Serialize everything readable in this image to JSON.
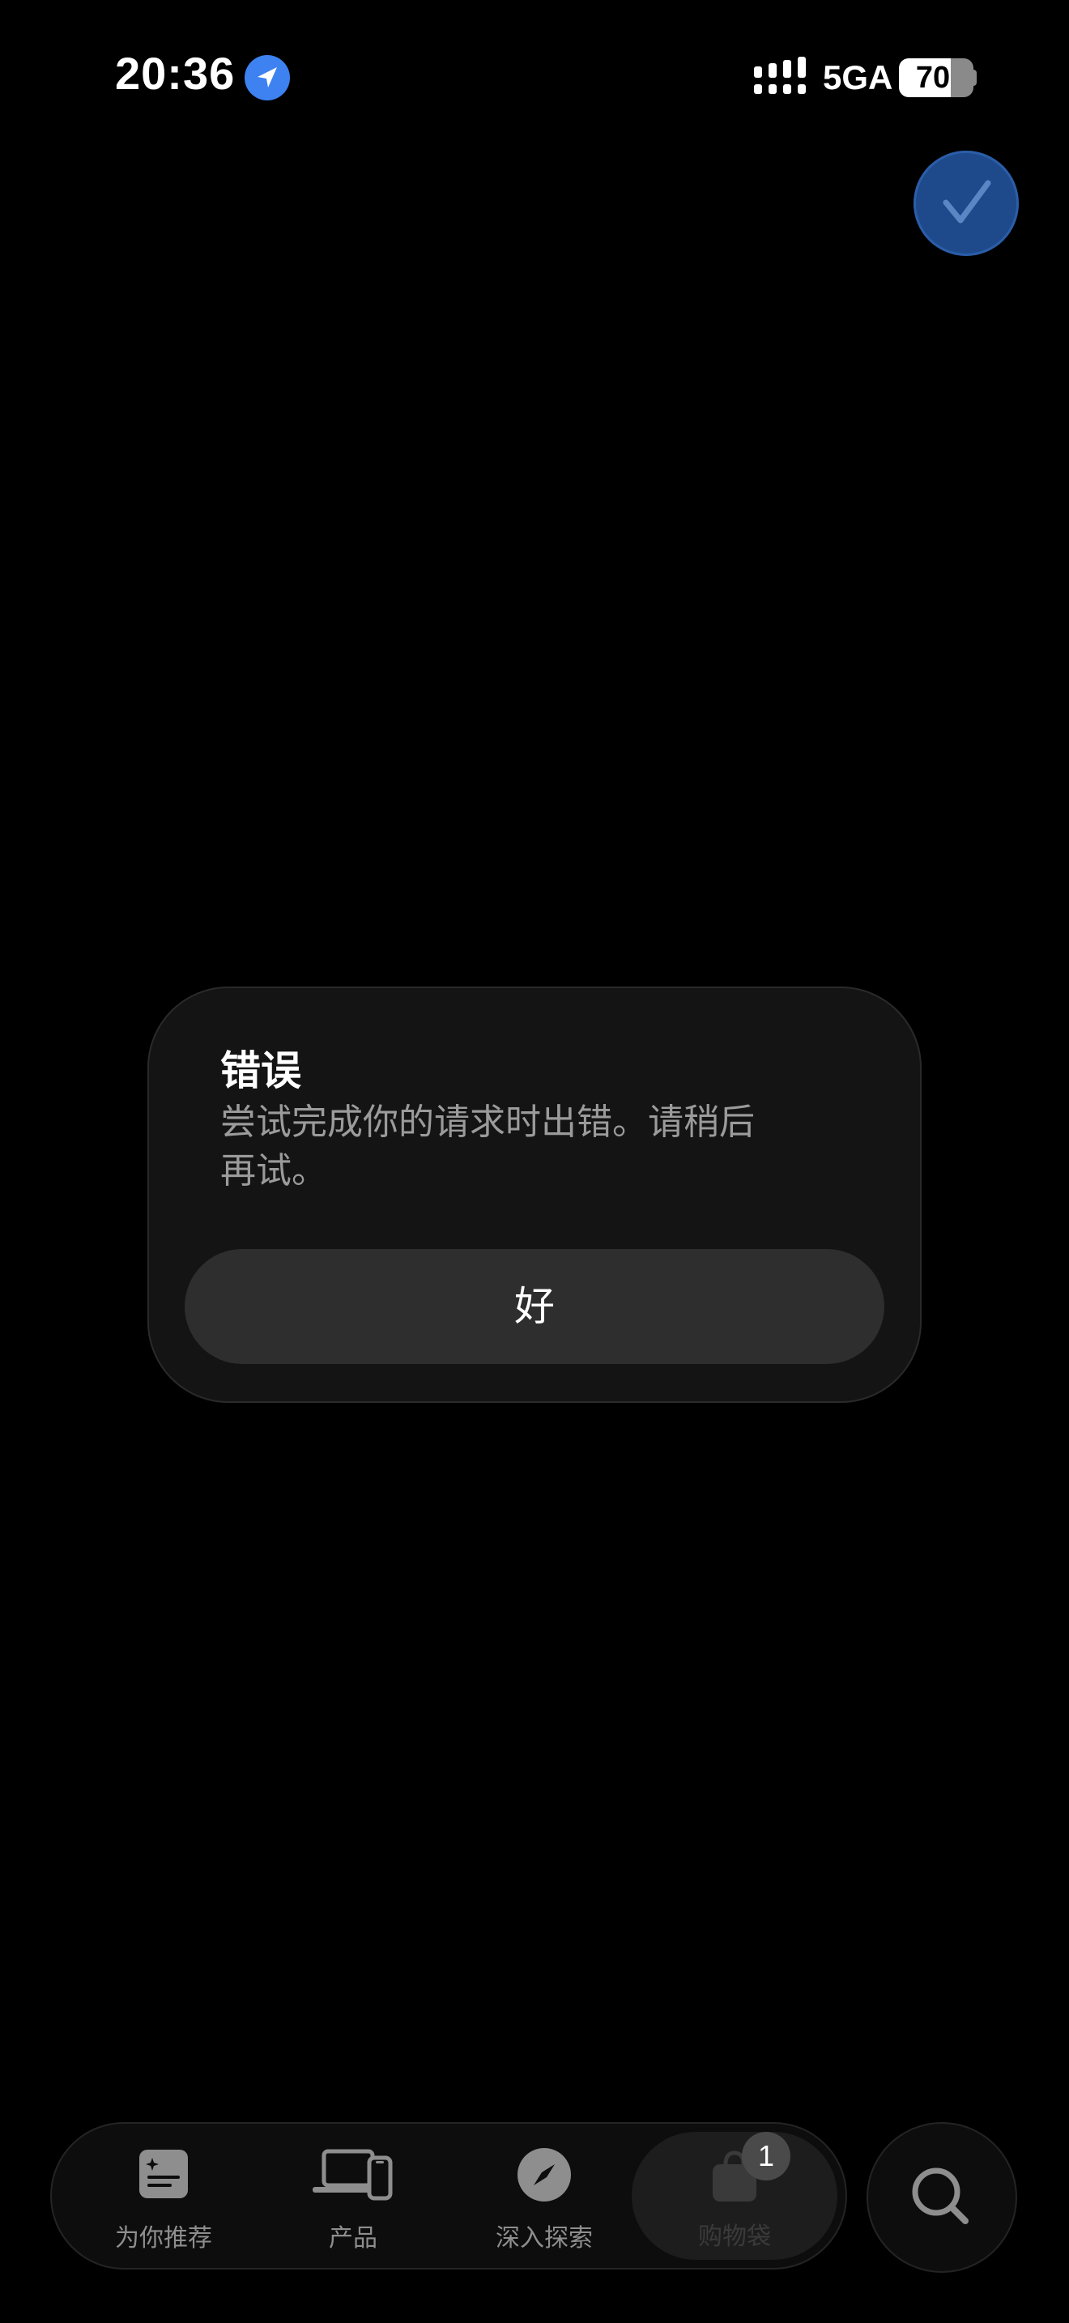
{
  "status_bar": {
    "time": "20:36",
    "network": "5GA",
    "battery_level": "70",
    "battery_fraction": 0.7,
    "icons": [
      "location-arrow-icon",
      "signal-icon",
      "battery-icon"
    ]
  },
  "floating_action": {
    "icon": "checkmark-icon",
    "color": "#1e4a8c"
  },
  "alert": {
    "title": "错误",
    "message": "尝试完成你的请求时出错。请稍后再试。",
    "ok_label": "好"
  },
  "tab_bar": {
    "tabs": [
      {
        "label": "为你推荐",
        "icon": "for-you-icon"
      },
      {
        "label": "产品",
        "icon": "devices-icon"
      },
      {
        "label": "深入探索",
        "icon": "compass-icon"
      },
      {
        "label": "购物袋",
        "icon": "shopping-bag-icon",
        "badge": "1"
      }
    ],
    "search_icon": "search-icon"
  },
  "colors": {
    "background": "#000000",
    "dialog": "#141414",
    "dialog_button": "#2e2e2e",
    "accent_blue": "#3d82f0"
  }
}
